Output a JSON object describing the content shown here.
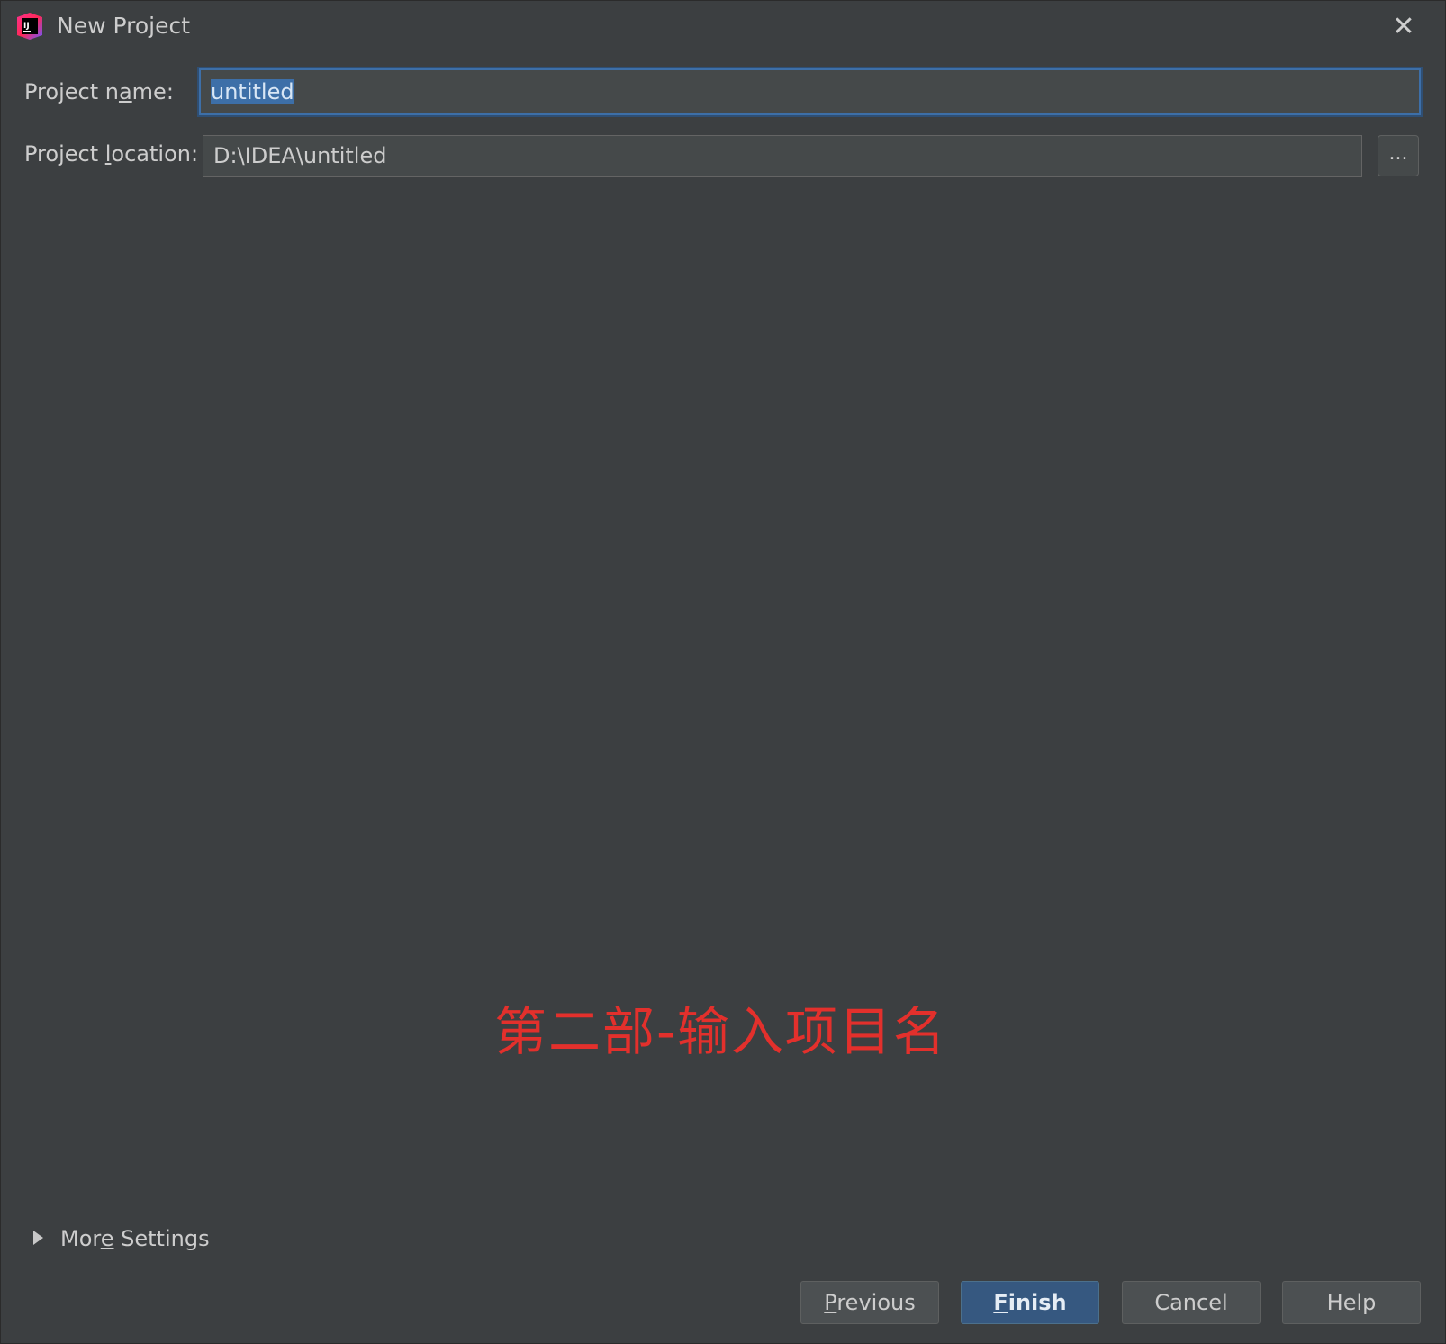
{
  "window": {
    "title": "New Project",
    "app_icon": "intellij-idea-icon",
    "close_icon": "close-icon"
  },
  "form": {
    "project_name": {
      "label_pre": "Project n",
      "label_mnemonic": "a",
      "label_post": "me:",
      "value": "untitled"
    },
    "project_location": {
      "label_pre": "Project ",
      "label_mnemonic": "l",
      "label_post": "ocation:",
      "value": "D:\\IDEA\\untitled",
      "browse_label": "..."
    }
  },
  "annotation": {
    "text": "第二部-输入项目名",
    "color": "#e3302c"
  },
  "more_settings": {
    "label_pre": "Mor",
    "label_mnemonic": "e",
    "label_post": " Settings",
    "expanded": false
  },
  "buttons": {
    "previous": {
      "mnemonic": "P",
      "rest": "revious"
    },
    "finish": {
      "mnemonic": "F",
      "rest": "inish"
    },
    "cancel": {
      "label": "Cancel"
    },
    "help": {
      "label": "Help"
    }
  },
  "colors": {
    "background": "#3c3f41",
    "focus_accent": "#3d6fa8",
    "primary_button": "#365880"
  }
}
